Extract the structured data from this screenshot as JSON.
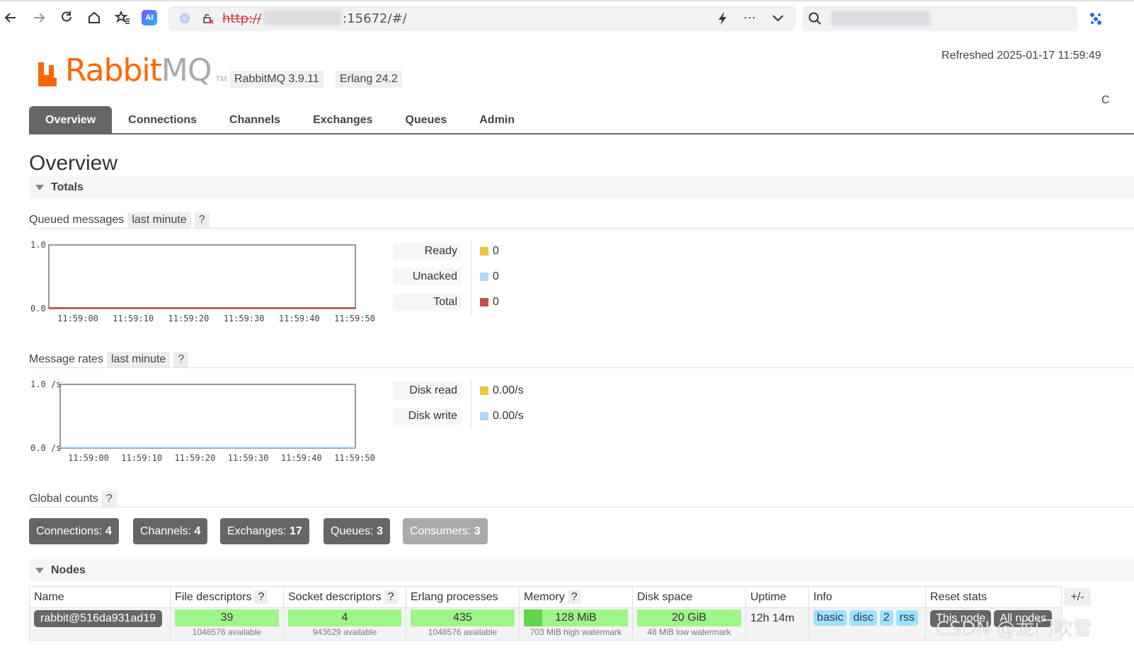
{
  "browser": {
    "url_protocol": "http://",
    "url_rest": ":15672/#/",
    "icons": [
      "back-icon",
      "forward-icon",
      "reload-icon",
      "home-icon",
      "favorites-icon",
      "ai-icon",
      "lightning-icon",
      "more-icon",
      "chevron-down-icon",
      "search-icon"
    ]
  },
  "header": {
    "logo_rabbit": "Rabbit",
    "logo_mq": "MQ",
    "logo_tm": "TM",
    "rabbitmq_version": "RabbitMQ 3.9.11",
    "erlang_version": "Erlang 24.2",
    "refreshed": "Refreshed 2025-01-17 11:59:49",
    "cut_text": "C"
  },
  "tabs": [
    "Overview",
    "Connections",
    "Channels",
    "Exchanges",
    "Queues",
    "Admin"
  ],
  "active_tab": "Overview",
  "page_title": "Overview",
  "totals": {
    "title": "Totals",
    "queued": {
      "label": "Queued messages",
      "range": "last minute",
      "help": "?",
      "legend": [
        {
          "name": "Ready",
          "value": "0",
          "color": "#edc240"
        },
        {
          "name": "Unacked",
          "value": "0",
          "color": "#afd8f8"
        },
        {
          "name": "Total",
          "value": "0",
          "color": "#cb4b4b"
        }
      ]
    },
    "rates": {
      "label": "Message rates",
      "range": "last minute",
      "help": "?",
      "legend": [
        {
          "name": "Disk read",
          "value": "0.00/s",
          "color": "#edc240"
        },
        {
          "name": "Disk write",
          "value": "0.00/s",
          "color": "#afd8f8"
        }
      ]
    },
    "global_counts": {
      "label": "Global counts",
      "help": "?",
      "items": [
        {
          "label": "Connections:",
          "value": "4"
        },
        {
          "label": "Channels:",
          "value": "4"
        },
        {
          "label": "Exchanges:",
          "value": "17"
        },
        {
          "label": "Queues:",
          "value": "3"
        },
        {
          "label": "Consumers:",
          "value": "3"
        }
      ]
    }
  },
  "chart_data": [
    {
      "type": "line",
      "x": [
        "11:59:00",
        "11:59:10",
        "11:59:20",
        "11:59:30",
        "11:59:40",
        "11:59:50"
      ],
      "yticks": [
        "0.0",
        "1.0"
      ],
      "ylim": [
        0,
        1
      ],
      "series": [
        {
          "name": "Ready",
          "values": [
            0,
            0,
            0,
            0,
            0,
            0
          ],
          "color": "#edc240"
        },
        {
          "name": "Unacked",
          "values": [
            0,
            0,
            0,
            0,
            0,
            0
          ],
          "color": "#afd8f8"
        },
        {
          "name": "Total",
          "values": [
            0,
            0,
            0,
            0,
            0,
            0
          ],
          "color": "#cb4b4b"
        }
      ]
    },
    {
      "type": "line",
      "x": [
        "11:59:00",
        "11:59:10",
        "11:59:20",
        "11:59:30",
        "11:59:40",
        "11:59:50"
      ],
      "yticks": [
        "0.0 /s",
        "1.0 /s"
      ],
      "ylim": [
        0,
        1
      ],
      "series": [
        {
          "name": "Disk read",
          "values": [
            0,
            0,
            0,
            0,
            0,
            0
          ],
          "color": "#edc240"
        },
        {
          "name": "Disk write",
          "values": [
            0,
            0,
            0,
            0,
            0,
            0
          ],
          "color": "#afd8f8"
        }
      ]
    }
  ],
  "nodes": {
    "title": "Nodes",
    "columns": [
      "Name",
      "File descriptors",
      "Socket descriptors",
      "Erlang processes",
      "Memory",
      "Disk space",
      "Uptime",
      "Info",
      "Reset stats"
    ],
    "help": "?",
    "plusminus": "+/-",
    "row": {
      "name": "rabbit@516da931ad19",
      "file_descriptors": "39",
      "file_descriptors_sub": "1048576 available",
      "socket_descriptors": "4",
      "socket_descriptors_sub": "943629 available",
      "erlang_processes": "435",
      "erlang_processes_sub": "1048576 available",
      "memory": "128 MiB",
      "memory_sub": "703 MiB high watermark",
      "memory_fraction": 0.18,
      "disk_space": "20 GiB",
      "disk_space_sub": "48 MiB low watermark",
      "uptime": "12h 14m",
      "info_tags": [
        "basic",
        "disc",
        "2",
        "rss"
      ],
      "reset_this": "This node",
      "reset_all": "All nodes"
    }
  },
  "watermark": "CSDN @龙门吹雪"
}
